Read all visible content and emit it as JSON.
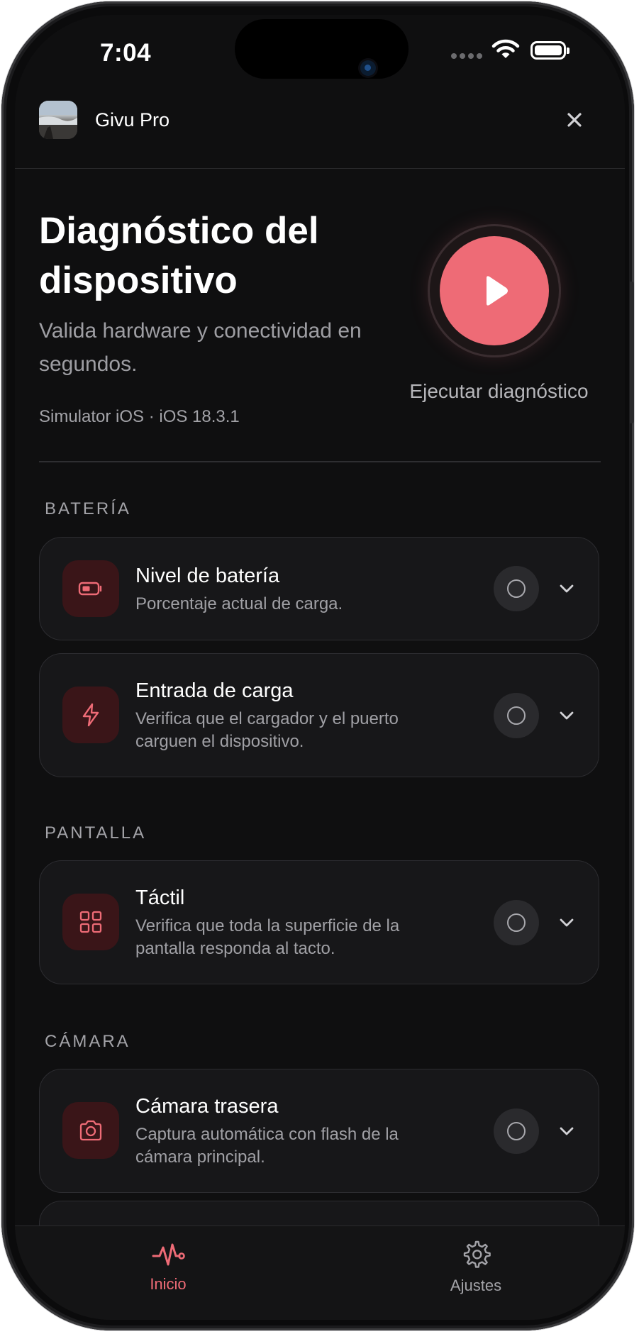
{
  "status_bar": {
    "time": "7:04"
  },
  "app_bar": {
    "app_name": "Givu Pro",
    "close_icon": "close-icon"
  },
  "header": {
    "title": "Diagnóstico del dispositivo",
    "subtitle": "Valida hardware y conectividad en segundos.",
    "device_info": "Simulator iOS · iOS 18.3.1",
    "run_label": "Ejecutar diagnóstico"
  },
  "sections": [
    {
      "title": "BATERÍA",
      "items": [
        {
          "title": "Nivel de batería",
          "description": "Porcentaje actual de carga.",
          "icon": "battery-icon"
        },
        {
          "title": "Entrada de carga",
          "description": "Verifica que el cargador y el puerto carguen el dispositivo.",
          "icon": "bolt-icon"
        }
      ]
    },
    {
      "title": "PANTALLA",
      "items": [
        {
          "title": "Táctil",
          "description": "Verifica que toda la superficie de la pantalla responda al tacto.",
          "icon": "grid-icon"
        }
      ]
    },
    {
      "title": "CÁMARA",
      "items": [
        {
          "title": "Cámara trasera",
          "description": "Captura automática con flash de la cámara principal.",
          "icon": "camera-icon"
        }
      ]
    }
  ],
  "tab_bar": {
    "tabs": [
      {
        "label": "Inicio",
        "icon": "pulse-icon",
        "active": true
      },
      {
        "label": "Ajustes",
        "icon": "gear-icon",
        "active": false
      }
    ]
  },
  "colors": {
    "accent": "#ee6b76",
    "background": "#0f0f10",
    "card": "#171719",
    "icon_tile": "#3a1518"
  }
}
